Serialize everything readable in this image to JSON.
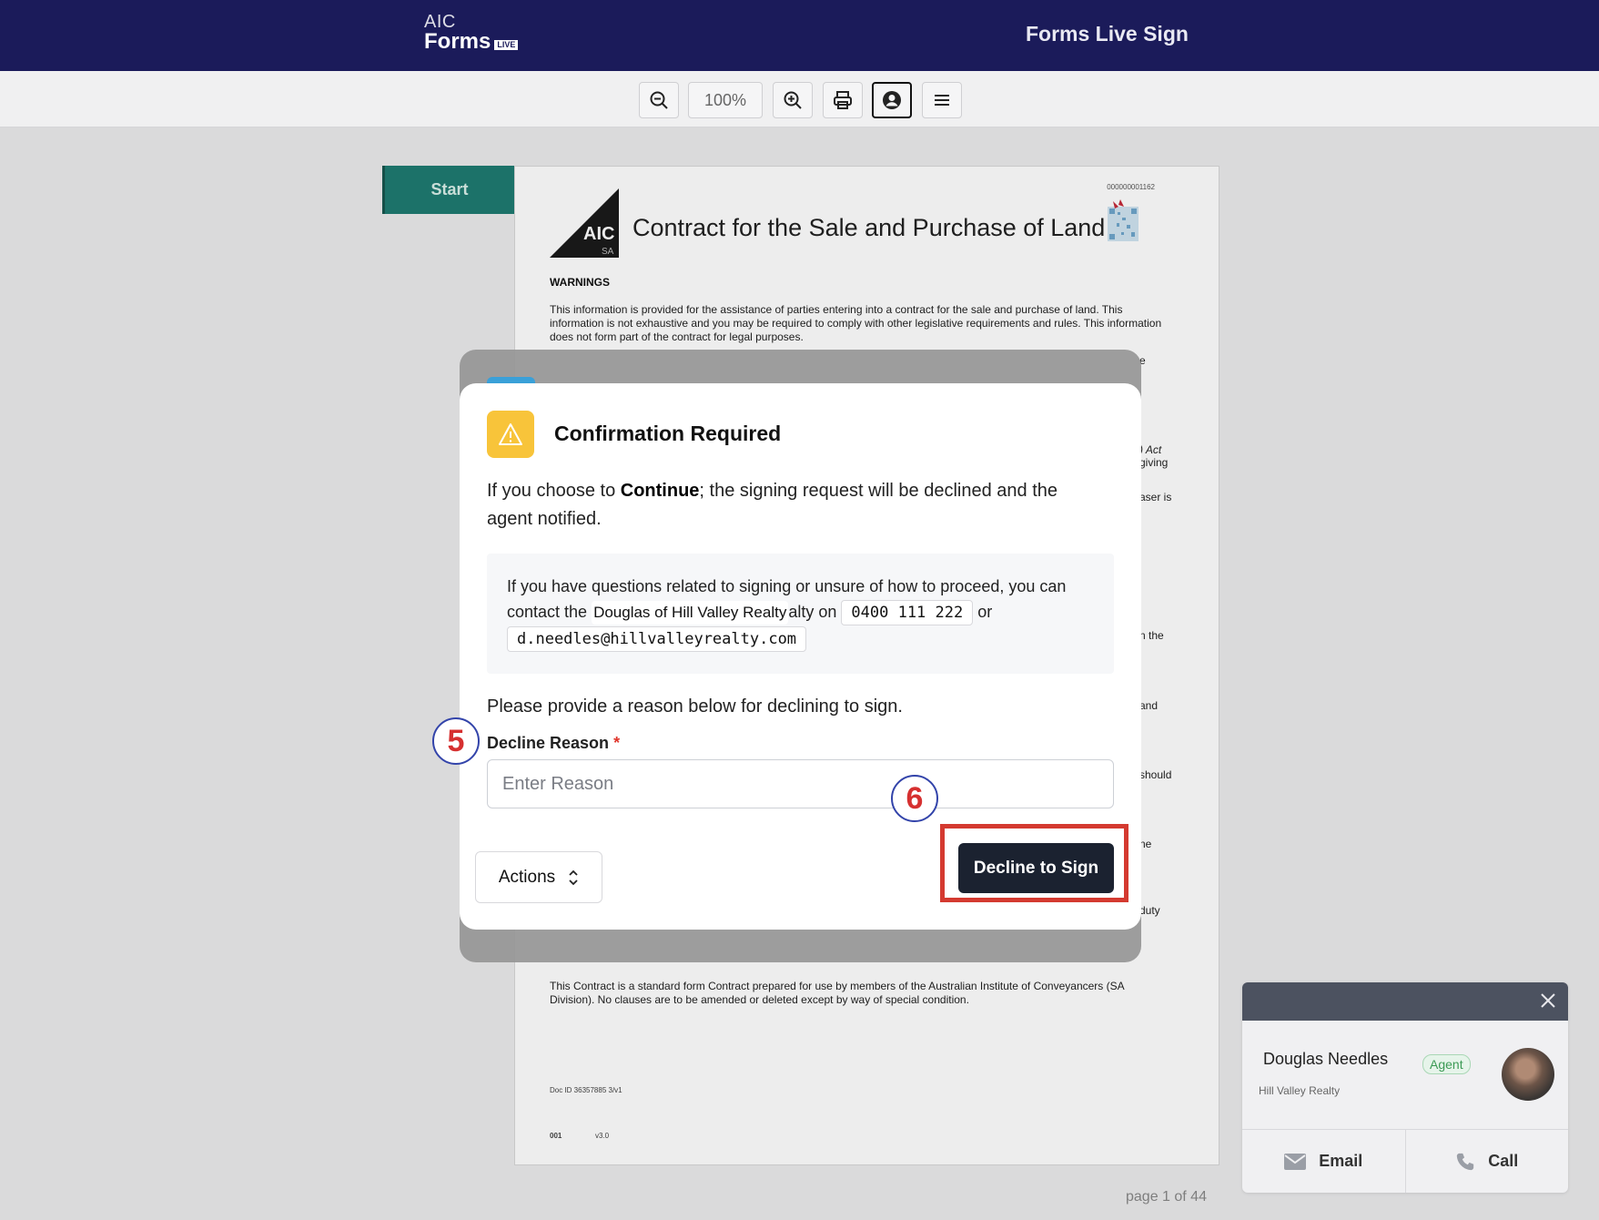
{
  "header": {
    "logo_top": "AIC",
    "logo_main": "Forms",
    "logo_badge": "LIVE",
    "app_title": "Forms Live Sign"
  },
  "toolbar": {
    "zoom_level": "100%",
    "icons": [
      "zoom-out-icon",
      "zoom-in-icon",
      "print-icon",
      "user-icon",
      "menu-icon"
    ]
  },
  "workspace": {
    "start_label": "Start",
    "page_indicator": "page 1 of 44"
  },
  "document": {
    "doc_number": "000000001162",
    "logo_text": "AIC",
    "logo_sub": "SA",
    "title": "Contract for the Sale and Purchase of Land",
    "warnings_heading": "WARNINGS",
    "warnings_text": "This information is provided for the assistance of parties entering into a contract for the sale and purchase of land. This information is not exhaustive and you may be required to comply with other legislative requirements and rules. This information does not form part of the contract for legal purposes.",
    "fragments": [
      "e",
      ") Act",
      "giving",
      "aser is",
      "n the",
      "and",
      "should",
      "ne",
      "duty"
    ],
    "footer_text": "This Contract is a standard form Contract prepared for use by members of the Australian Institute of Conveyancers (SA Division). No clauses are to be amended or deleted except by way of special condition.",
    "doc_id": "Doc ID 36357885 3/v1",
    "code_left": "001",
    "code_right": "v3.0"
  },
  "modal": {
    "title": "Confirmation Required",
    "intro_pre": "If you choose to ",
    "intro_bold": "Continue",
    "intro_post": "; the signing request will be declined and the agent notified.",
    "contact_pre": "If you have questions related to signing or unsure of how to proceed, you can contact the ",
    "contact_name": "Douglas of Hill Valley Realty",
    "contact_mid_tail": "alty on",
    "contact_phone": "0400 111 222",
    "contact_or": "or",
    "contact_email": "d.needles@hillvalleyrealty.com",
    "prompt": "Please provide a reason below for declining to sign.",
    "field_label": "Decline Reason",
    "required_mark": "*",
    "input_placeholder": "Enter Reason",
    "input_value": "",
    "actions_label": "Actions",
    "decline_label": "Decline to Sign"
  },
  "steps": {
    "reason_step": "5",
    "decline_step": "6"
  },
  "agent_card": {
    "name": "Douglas Needles",
    "role": "Agent",
    "company": "Hill Valley Realty",
    "email_label": "Email",
    "call_label": "Call"
  },
  "colors": {
    "header_bg": "#1b1b5a",
    "start_tab": "#1f7b72",
    "warning_badge": "#f8c43a",
    "decline_button": "#1b2230",
    "highlight": "#d43a30",
    "agent_badge": "#3c9a55"
  }
}
